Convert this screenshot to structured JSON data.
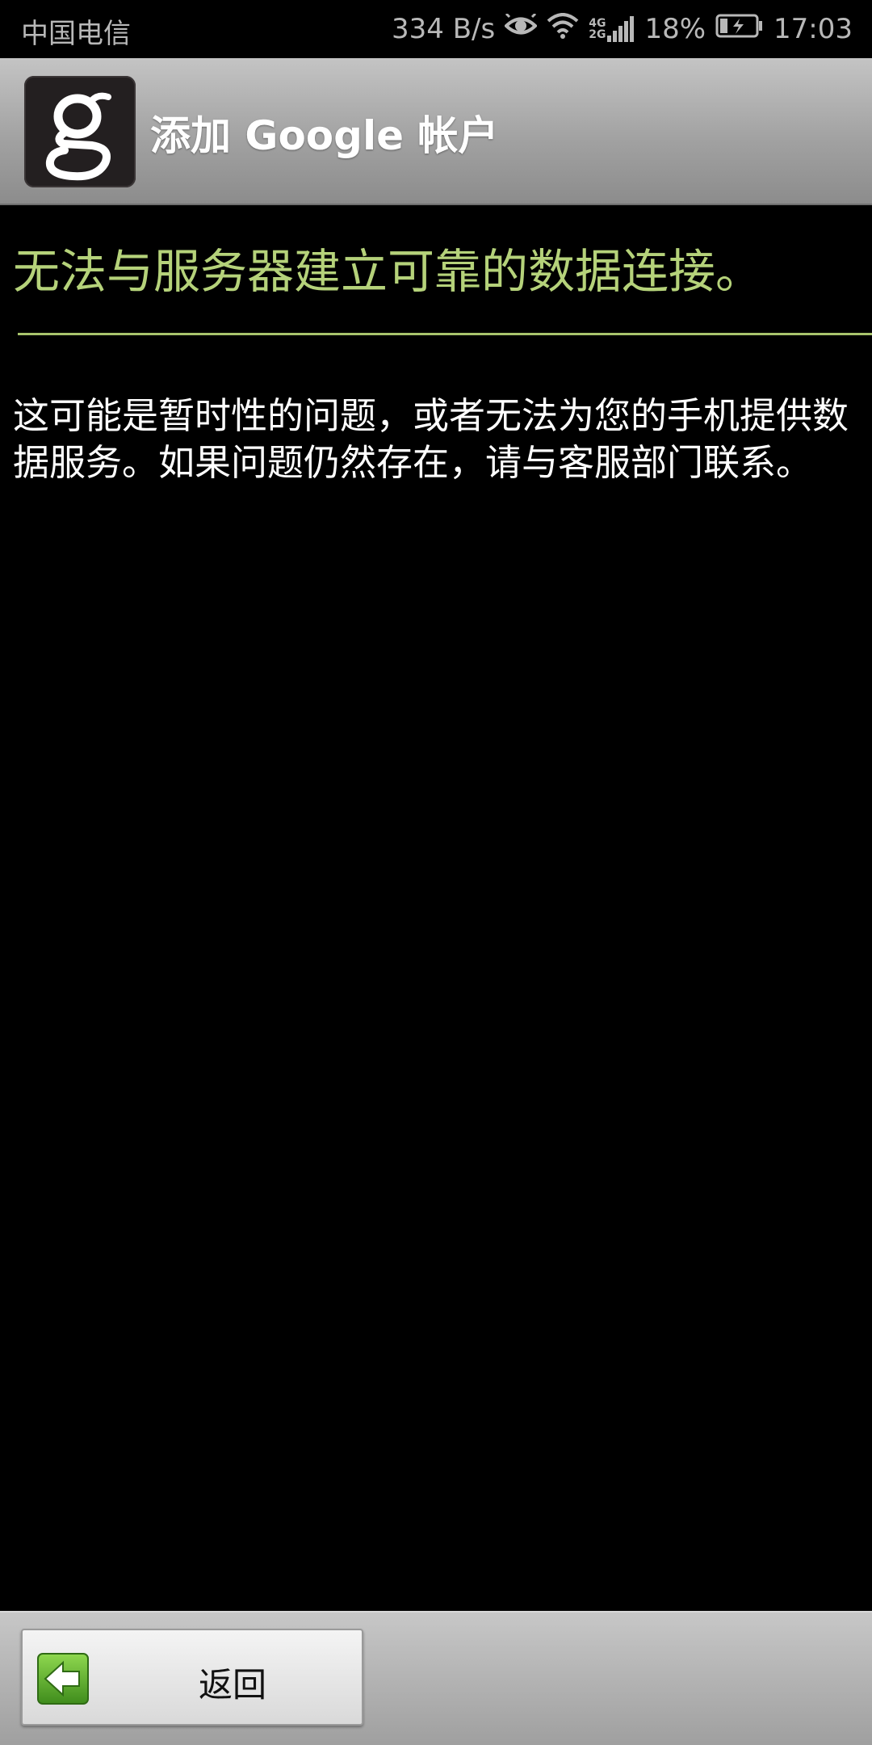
{
  "status_bar": {
    "carrier": "中国电信",
    "net_speed": "334 B/s",
    "signal_label_top": "4G",
    "signal_label_bottom": "2G",
    "battery": "18%",
    "time": "17:03",
    "icons": [
      "eye-icon",
      "wifi-icon",
      "signal-icon",
      "battery-charging-icon"
    ]
  },
  "header": {
    "app_icon": "google-g-icon",
    "title": "添加 Google 帐户"
  },
  "main": {
    "headline": "无法与服务器建立可靠的数据连接。",
    "message": "这可能是暂时性的问题，或者无法为您的手机提供数据服务。如果问题仍然存在，请与客服部门联系。"
  },
  "footer": {
    "back_label": "返回",
    "back_icon": "back-arrow-icon"
  },
  "colors": {
    "headline": "#b5d27a",
    "background": "#000000",
    "arrow_green": "#5aa52a"
  }
}
